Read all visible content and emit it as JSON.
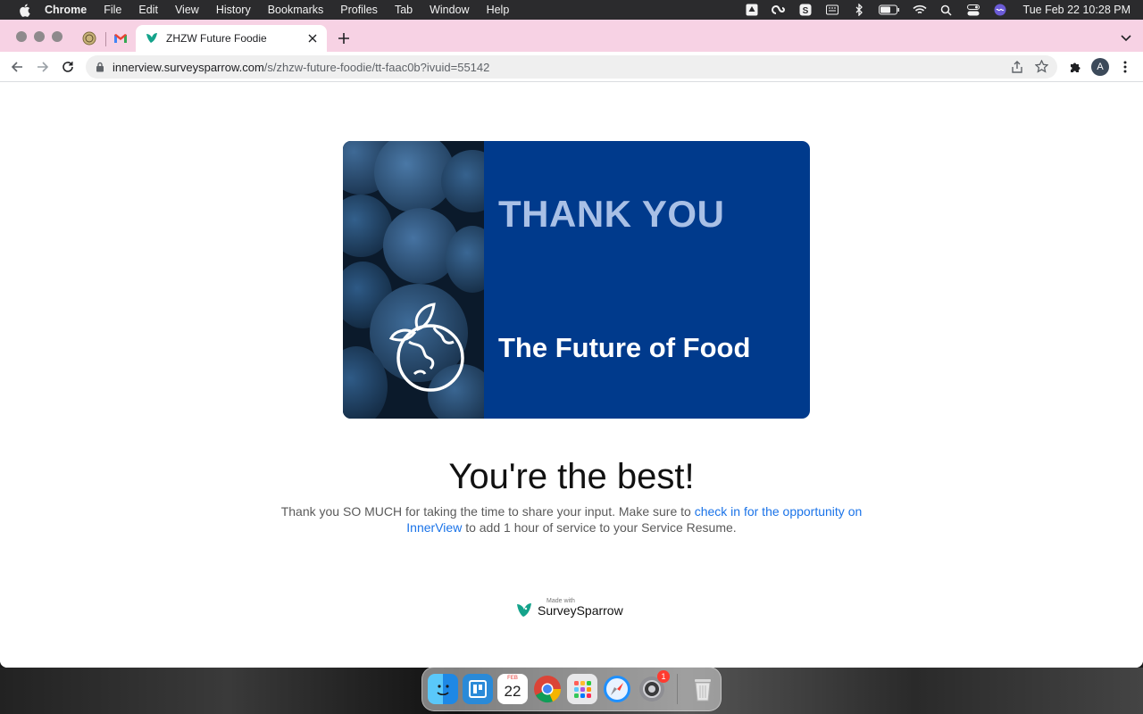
{
  "menubar": {
    "app": "Chrome",
    "items": [
      "File",
      "Edit",
      "View",
      "History",
      "Bookmarks",
      "Profiles",
      "Tab",
      "Window",
      "Help"
    ],
    "clock": "Tue Feb 22  10:28 PM"
  },
  "browser": {
    "tab_title": "ZHZW Future Foodie",
    "url_host": "innerview.surveysparrow.com",
    "url_path": "/s/zhzw-future-foodie/tt-faac0b?ivuid=55142",
    "profile_initial": "A"
  },
  "page": {
    "banner_line1": "THANK YOU",
    "banner_line2": "The Future of Food",
    "headline": "You're the best!",
    "message_before": "Thank you SO MUCH for taking the time to share your input. Make sure to ",
    "message_link": "check in for the opportunity on InnerView",
    "message_after": " to add 1 hour of service to your Service Resume.",
    "made_with": "Made with",
    "brand": "SurveySparrow"
  },
  "dock": {
    "calendar_month": "FEB",
    "calendar_day": "22",
    "settings_badge": "1"
  },
  "colors": {
    "tabstrip": "#f7d2e4",
    "banner_blue": "#003a8c",
    "link": "#1a73e8",
    "brand_green": "#14a38b"
  }
}
